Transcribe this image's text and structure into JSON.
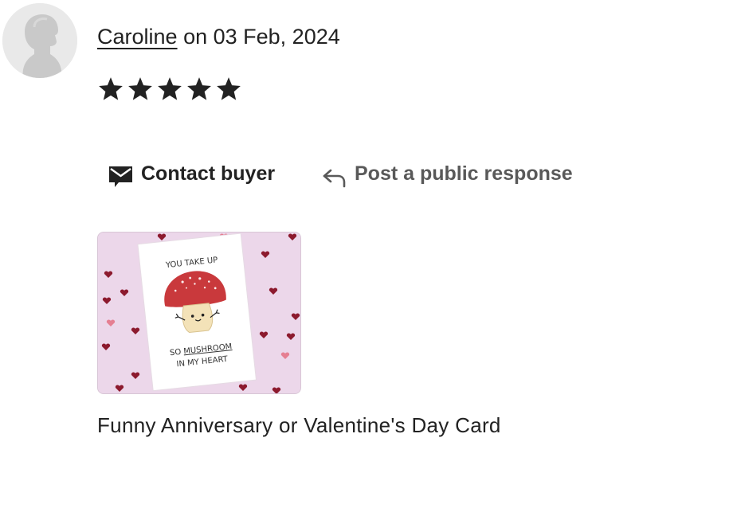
{
  "review": {
    "reviewer_name": "Caroline",
    "date_text": "on 03 Feb, 2024",
    "rating": 5,
    "rating_max": 5
  },
  "actions": {
    "contact_label": "Contact buyer",
    "public_response_label": "Post a public response"
  },
  "listing": {
    "title": "Funny Anniversary or Valentine's Day Card",
    "card_text_top": "YOU TAKE UP",
    "card_text_mid_prefix": "SO ",
    "card_text_mid_underlined": "MUSHROOM",
    "card_text_bottom": "IN MY HEART"
  },
  "colors": {
    "text": "#222222",
    "muted_text": "#595959",
    "thumb_background": "#ecd7ea",
    "mushroom_cap": "#c9393c",
    "heart": "#8c1a2e"
  },
  "icons": {
    "avatar": "default-user-icon",
    "star": "star-icon",
    "contact": "mail-icon",
    "reply": "reply-arrow-icon"
  }
}
